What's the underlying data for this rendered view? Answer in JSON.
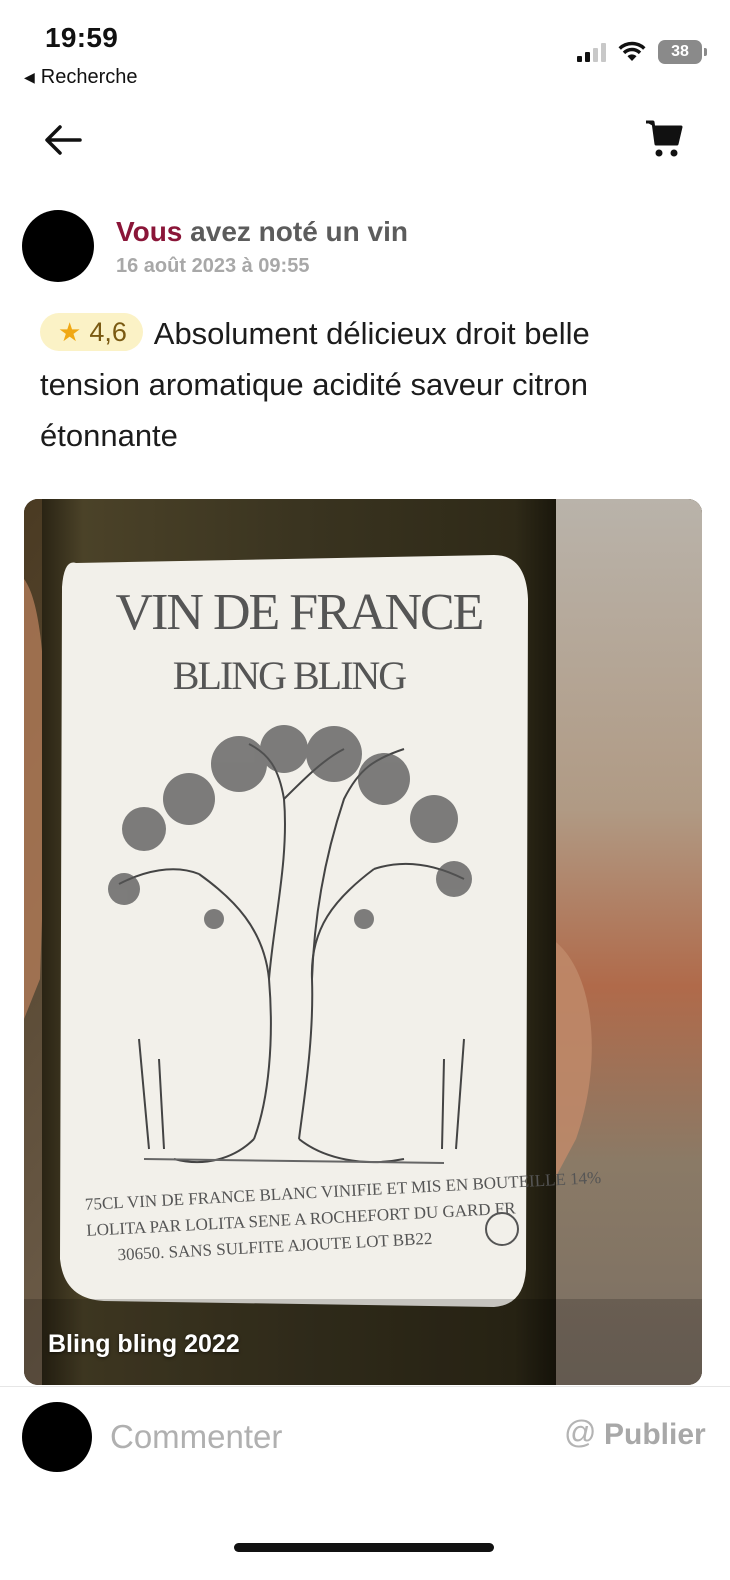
{
  "status_bar": {
    "time": "19:59",
    "back_app": "Recherche",
    "battery": "38"
  },
  "nav": {
    "back_icon": "arrow-left-icon",
    "cart_icon": "cart-icon"
  },
  "post": {
    "actor": "Vous",
    "action": "avez noté un vin",
    "date": "16 août 2023 à 09:55",
    "rating": "4,6",
    "review_text": "Absolument délicieux droit belle tension aromatique acidité saveur citron étonnante",
    "photo": {
      "caption": "Bling bling 2022",
      "label_title": "VIN DE FRANCE",
      "label_name": "BLING BLING",
      "label_line1": "75CL VIN DE FRANCE BLANC VINIFIE ET MIS EN BOUTEILLE 14%",
      "label_line2": "LOLITA PAR LOLITA SENE A ROCHEFORT DU GARD FR",
      "label_line3": "30650. SANS SULFITE AJOUTE LOT BB22"
    }
  },
  "comment_bar": {
    "placeholder": "Commenter",
    "mention_symbol": "@",
    "publish_label": "Publier"
  },
  "colors": {
    "accent": "#8a1538",
    "rating_bg": "#fbf2c6",
    "star": "#f0a814"
  }
}
